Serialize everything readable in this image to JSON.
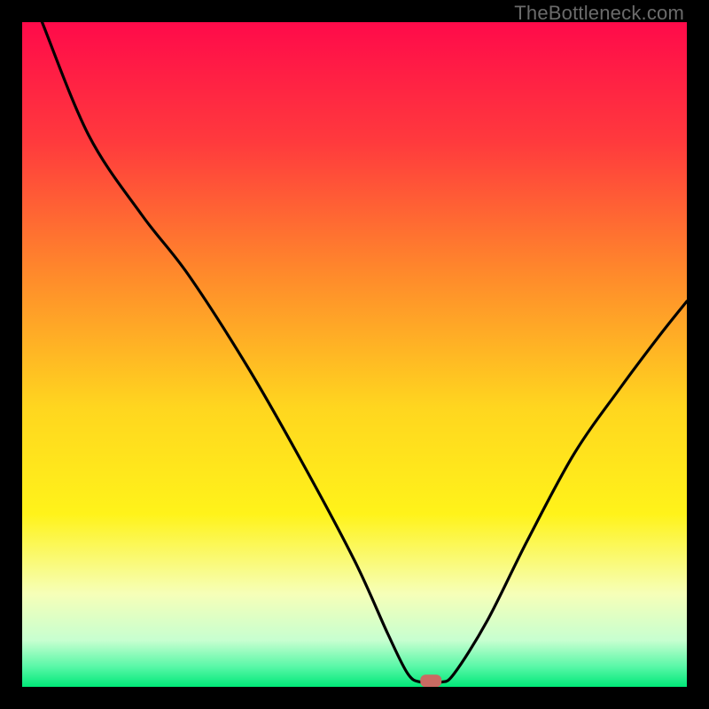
{
  "watermark": "TheBottleneck.com",
  "chart_data": {
    "type": "line",
    "title": "",
    "xlabel": "",
    "ylabel": "",
    "xlim": [
      0,
      100
    ],
    "ylim": [
      0,
      100
    ],
    "gradient_stops": [
      {
        "offset": 0.0,
        "color": "#ff0a4a"
      },
      {
        "offset": 0.18,
        "color": "#ff3a3d"
      },
      {
        "offset": 0.38,
        "color": "#ff8a2b"
      },
      {
        "offset": 0.58,
        "color": "#ffd61f"
      },
      {
        "offset": 0.74,
        "color": "#fff31a"
      },
      {
        "offset": 0.86,
        "color": "#f6ffb8"
      },
      {
        "offset": 0.93,
        "color": "#c7ffd0"
      },
      {
        "offset": 0.97,
        "color": "#58f7a7"
      },
      {
        "offset": 1.0,
        "color": "#00e878"
      }
    ],
    "series": [
      {
        "name": "bottleneck-curve",
        "points": [
          {
            "x": 3.0,
            "y": 100.0
          },
          {
            "x": 10.0,
            "y": 83.0
          },
          {
            "x": 18.0,
            "y": 71.0
          },
          {
            "x": 25.0,
            "y": 62.0
          },
          {
            "x": 34.0,
            "y": 48.0
          },
          {
            "x": 42.0,
            "y": 34.0
          },
          {
            "x": 50.0,
            "y": 19.0
          },
          {
            "x": 55.0,
            "y": 8.0
          },
          {
            "x": 58.0,
            "y": 2.0
          },
          {
            "x": 60.0,
            "y": 0.7
          },
          {
            "x": 63.0,
            "y": 0.7
          },
          {
            "x": 65.0,
            "y": 2.0
          },
          {
            "x": 70.0,
            "y": 10.0
          },
          {
            "x": 76.0,
            "y": 22.0
          },
          {
            "x": 83.0,
            "y": 35.0
          },
          {
            "x": 90.0,
            "y": 45.0
          },
          {
            "x": 96.0,
            "y": 53.0
          },
          {
            "x": 100.0,
            "y": 58.0
          }
        ]
      }
    ],
    "marker": {
      "x": 61.5,
      "y": 0.9,
      "color": "#c96a62"
    }
  }
}
